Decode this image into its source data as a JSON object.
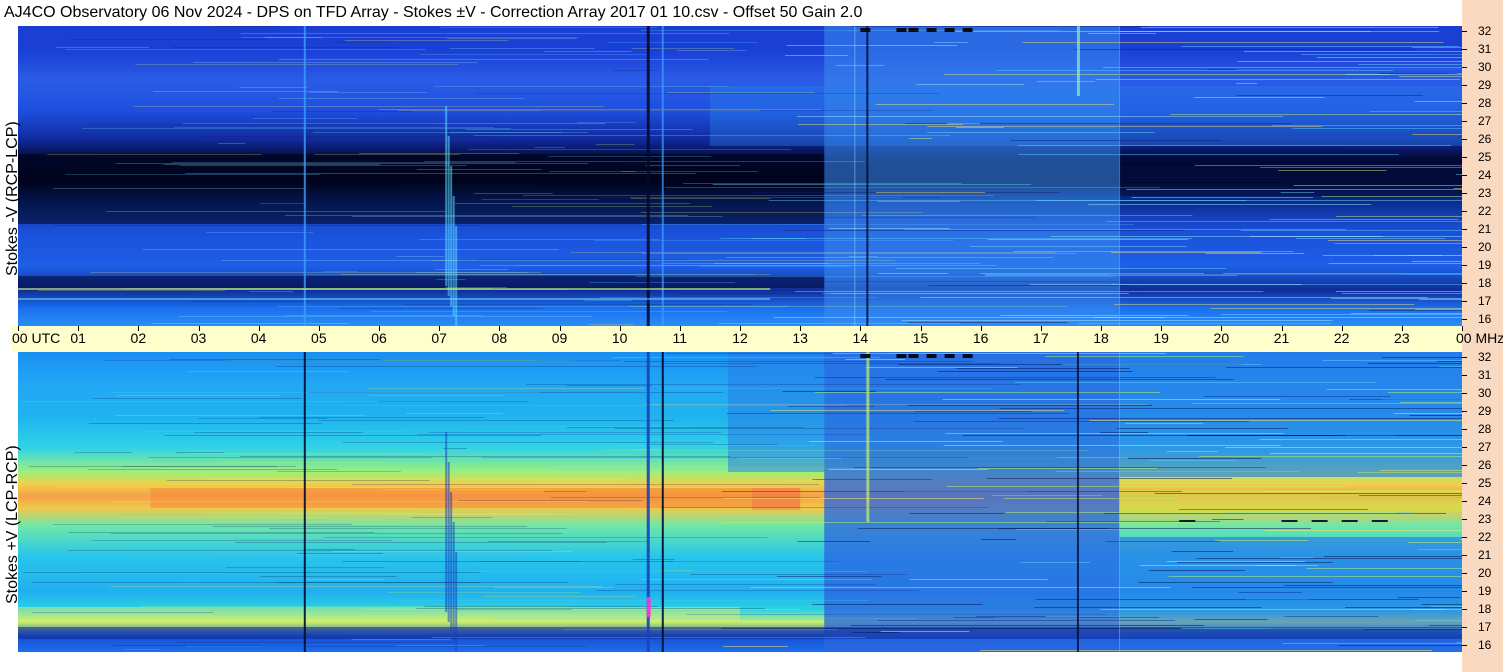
{
  "header": {
    "title": "AJ4CO Observatory  06 Nov 2024  -  DPS on TFD Array  -  Stokes ±V  -  Correction Array 2017 01 10.csv  -  Offset 50  Gain 2.0"
  },
  "chart_data": {
    "type": "heatmap",
    "title": "AJ4CO Observatory  06 Nov 2024  -  DPS on TFD Array  -  Stokes ±V  -  Correction Array 2017 01 10.csv  -  Offset 50  Gain 2.0",
    "x_axis": {
      "label_prefix": "UTC",
      "ticks": [
        "00",
        "01",
        "02",
        "03",
        "04",
        "05",
        "06",
        "07",
        "08",
        "09",
        "10",
        "11",
        "12",
        "13",
        "14",
        "15",
        "16",
        "17",
        "18",
        "19",
        "20",
        "21",
        "22",
        "23",
        "00"
      ],
      "range": [
        0,
        24
      ]
    },
    "y_axis": {
      "unit": "MHz",
      "ticks": [
        "16",
        "17",
        "18",
        "19",
        "20",
        "21",
        "22",
        "23",
        "24",
        "25",
        "26",
        "27",
        "28",
        "29",
        "30",
        "31",
        "32"
      ],
      "range": [
        16,
        32
      ]
    },
    "panels": [
      {
        "name": "Stokes -V  (RCP-LCP)",
        "palette": "cool-dark"
      },
      {
        "name": "Stokes +V  (LCP-RCP)",
        "palette": "warm"
      }
    ]
  }
}
